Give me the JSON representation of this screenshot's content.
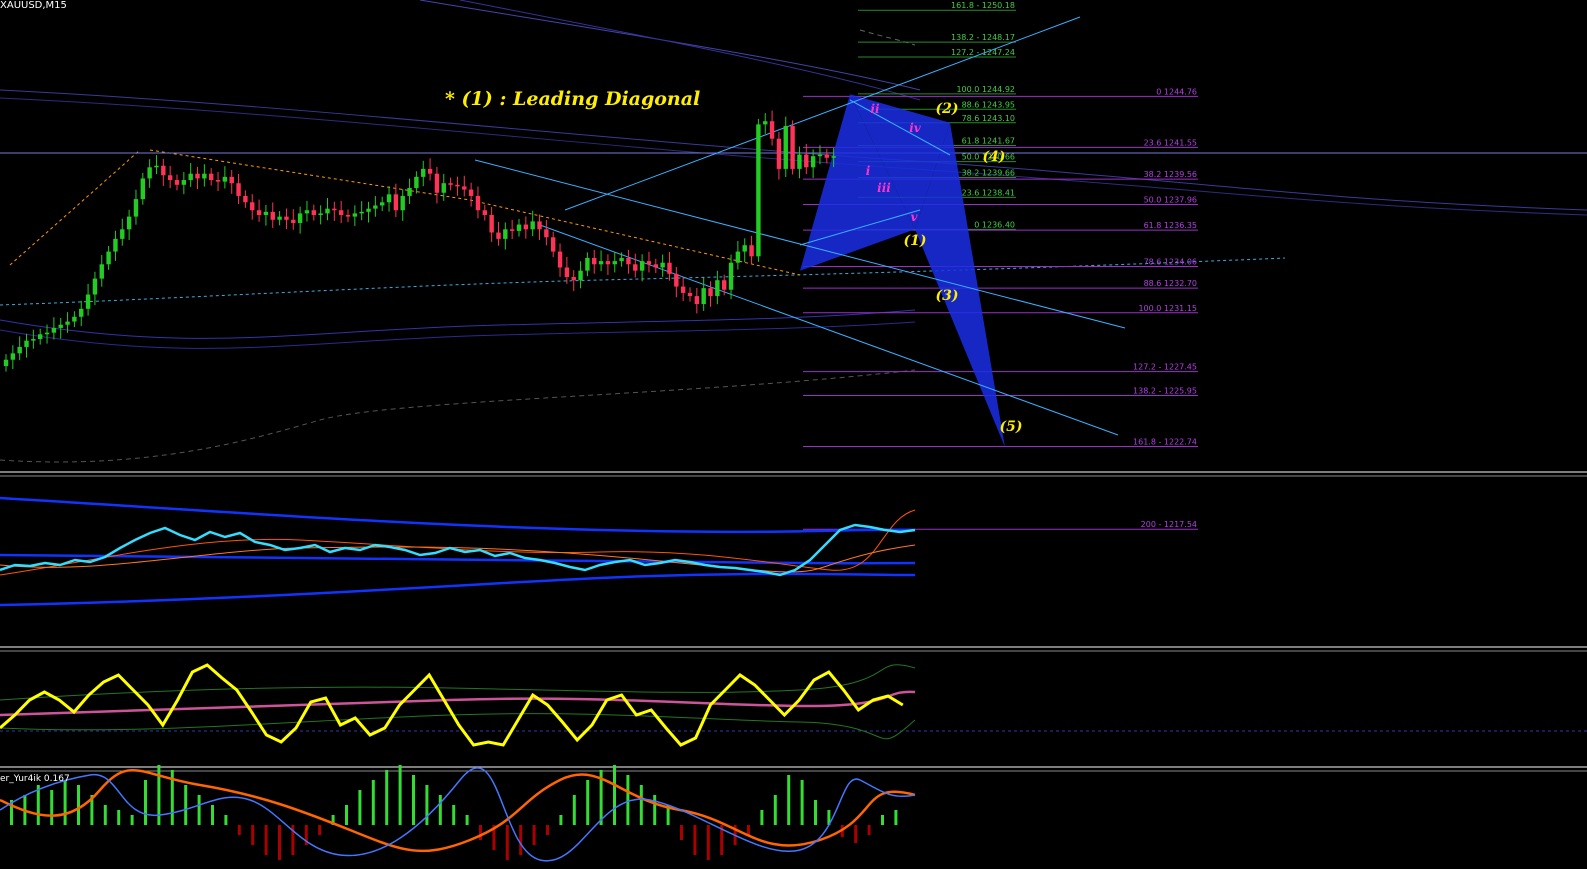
{
  "chart_data": {
    "type": "candlestick",
    "symbol_label": "XAUUSD,M15",
    "annotation_title": "* (1) : Leading Diagonal",
    "price_range": [
      1215,
      1254
    ],
    "candles_close": [
      1228.2,
      1228.6,
      1229.0,
      1229.4,
      1229.5,
      1229.8,
      1229.9,
      1230.2,
      1230.4,
      1230.6,
      1230.9,
      1231.4,
      1232.3,
      1233.3,
      1234.2,
      1235.0,
      1235.8,
      1236.4,
      1237.2,
      1238.3,
      1239.6,
      1240.3,
      1240.4,
      1239.8,
      1239.5,
      1239.2,
      1239.5,
      1239.9,
      1239.6,
      1239.9,
      1239.5,
      1239.4,
      1239.7,
      1239.3,
      1238.5,
      1238.1,
      1237.6,
      1237.3,
      1237.5,
      1237.0,
      1237.2,
      1237.0,
      1236.8,
      1237.4,
      1237.6,
      1237.3,
      1237.4,
      1237.7,
      1237.6,
      1237.3,
      1237.2,
      1237.4,
      1237.5,
      1237.7,
      1237.9,
      1238.1,
      1238.6,
      1237.6,
      1238.5,
      1239.0,
      1239.7,
      1240.2,
      1239.9,
      1238.7,
      1239.3,
      1239.2,
      1239.1,
      1238.9,
      1238.5,
      1237.6,
      1237.3,
      1236.2,
      1235.8,
      1236.4,
      1236.3,
      1236.7,
      1236.4,
      1236.9,
      1236.4,
      1235.9,
      1235.0,
      1234.0,
      1233.4,
      1233.2,
      1233.8,
      1234.6,
      1234.2,
      1234.4,
      1234.2,
      1234.4,
      1234.6,
      1234.2,
      1233.8,
      1234.4,
      1234.2,
      1234.0,
      1234.3,
      1233.6,
      1232.8,
      1232.4,
      1232.2,
      1231.7,
      1232.7,
      1232.2,
      1233.2,
      1232.6,
      1234.3,
      1235.0,
      1235.4,
      1234.7,
      1243.0,
      1243.2,
      1242.1,
      1240.2,
      1242.9,
      1240.2,
      1241.1,
      1240.3,
      1241.0,
      1241.1,
      1240.9,
      1241.0
    ],
    "fib_levels_left": [
      {
        "label": "161.8 - 1250.18",
        "price": 1250.18
      },
      {
        "label": "138.2 - 1248.17",
        "price": 1248.17
      },
      {
        "label": "127.2 - 1247.24",
        "price": 1247.24
      },
      {
        "label": "100.0 1244.92",
        "price": 1244.92
      },
      {
        "label": "88.6 1243.95",
        "price": 1243.95
      },
      {
        "label": "78.6 1243.10",
        "price": 1243.1
      },
      {
        "label": "61.8 1241.67",
        "price": 1241.67
      },
      {
        "label": "50.0 1240.66",
        "price": 1240.66
      },
      {
        "label": "38.2 1239.66",
        "price": 1239.66
      },
      {
        "label": "23.6 1238.41",
        "price": 1238.41
      },
      {
        "label": "0 1236.40",
        "price": 1236.4
      }
    ],
    "fib_levels_right": [
      {
        "label": "0 1244.76",
        "price": 1244.76
      },
      {
        "label": "23.6 1241.55",
        "price": 1241.55
      },
      {
        "label": "38.2 1239.56",
        "price": 1239.56
      },
      {
        "label": "50.0 1237.96",
        "price": 1237.96
      },
      {
        "label": "61.8 1236.35",
        "price": 1236.35
      },
      {
        "label": "78.6 1234.06",
        "price": 1234.06
      },
      {
        "label": "88.6 1232.70",
        "price": 1232.7
      },
      {
        "label": "100.0 1231.15",
        "price": 1231.15
      },
      {
        "label": "127.2 - 1227.45",
        "price": 1227.45
      },
      {
        "label": "138.2 - 1225.95",
        "price": 1225.95
      },
      {
        "label": "161.8 - 1222.74",
        "price": 1222.74
      },
      {
        "label": "200 - 1217.54",
        "price": 1217.54
      }
    ],
    "wave_labels_major": [
      "(1)",
      "(2)",
      "(3)",
      "(4)",
      "(5)"
    ],
    "wave_labels_minor": [
      "i",
      "ii",
      "iii",
      "iv",
      "v"
    ],
    "indicator3_label": "er_Yur4ik 0.167",
    "colors": {
      "background": "#000000",
      "bull_candle": "#22cc22",
      "bear_candle": "#ff3355",
      "channel_line": "#3ab0ff",
      "fib_line_left": "#2a8a2a",
      "fib_line_right": "#9b30c8",
      "fib_text_left": "#44cc44",
      "fib_text_right": "#b040e0",
      "harmonic_fill": "#1a2ee6",
      "wave_major": "#ffee00",
      "wave_minor": "#ff33cc",
      "annotation": "#ffee00",
      "oscillator_yellow": "#ffff00",
      "oscillator_cyan": "#33ddff",
      "histogram_green": "#33dd33",
      "histogram_red": "#aa0000"
    }
  }
}
